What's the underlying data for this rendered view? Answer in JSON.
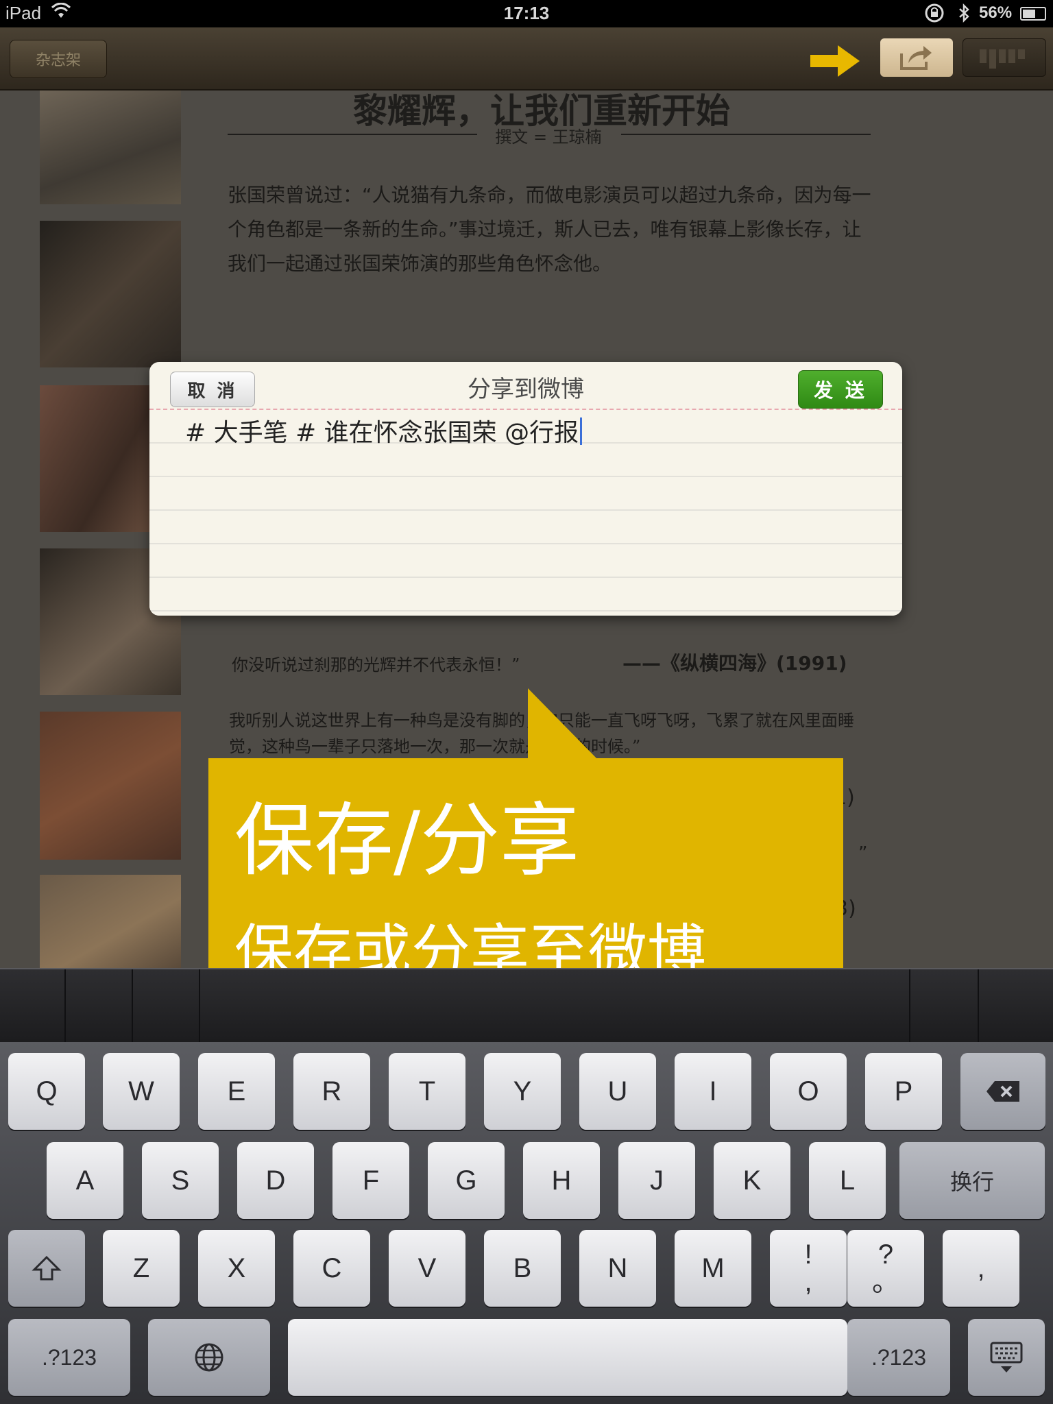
{
  "status_bar": {
    "carrier": "iPad",
    "time": "17:13",
    "battery": "56%"
  },
  "toolbar": {
    "shelf_label": "杂志架"
  },
  "article": {
    "title": "黎耀辉，让我们重新开始",
    "byline": "撰文 = 王琼楠",
    "intro": "张国荣曾说过：“人说猫有九条命，而做电影演员可以超过九条命，因为每一个角色都是一条新的生命。”事过境迁，斯人已去，唯有银幕上影像长存，让我们一起通过张国荣饰演的那些角色怀念他。",
    "quote1": "你没听说过刹那的光辉并不代表永恒！”",
    "quote1_source": "——《纵横四海》(1991)",
    "quote2": "我听别人说这世界上有一种鸟是没有脚的，它只能一直飞呀飞呀，飞累了就在风里面睡觉，这种鸟一辈子只落地一次，那一次就是它死的时候。”",
    "frag1": "1)",
    "frag2": "”",
    "frag3": "3)"
  },
  "share_dialog": {
    "title": "分享到微博",
    "cancel_label": "取 消",
    "send_label": "发 送",
    "text": "# 大手笔 # 谁在怀念张国荣 @行报"
  },
  "callout": {
    "title": "保存/分享",
    "subtitle": "保存或分享至微博"
  },
  "keyboard": {
    "row1": [
      "Q",
      "W",
      "E",
      "R",
      "T",
      "Y",
      "U",
      "I",
      "O",
      "P"
    ],
    "row2": [
      "A",
      "S",
      "D",
      "F",
      "G",
      "H",
      "J",
      "K",
      "L"
    ],
    "return_label": "换行",
    "row3": [
      "Z",
      "X",
      "C",
      "V",
      "B",
      "N",
      "M"
    ],
    "punct1_top": "!",
    "punct1_bottom": ",",
    "punct2_top": "?",
    "punct2_bottom": "。",
    "punct3": ",",
    "numbers_label": ".?123",
    "numbers_label_right": ".?123"
  },
  "colors": {
    "callout": "#e0b500",
    "send_button": "#3a9a1c",
    "hint_arrow": "#e8b800"
  }
}
